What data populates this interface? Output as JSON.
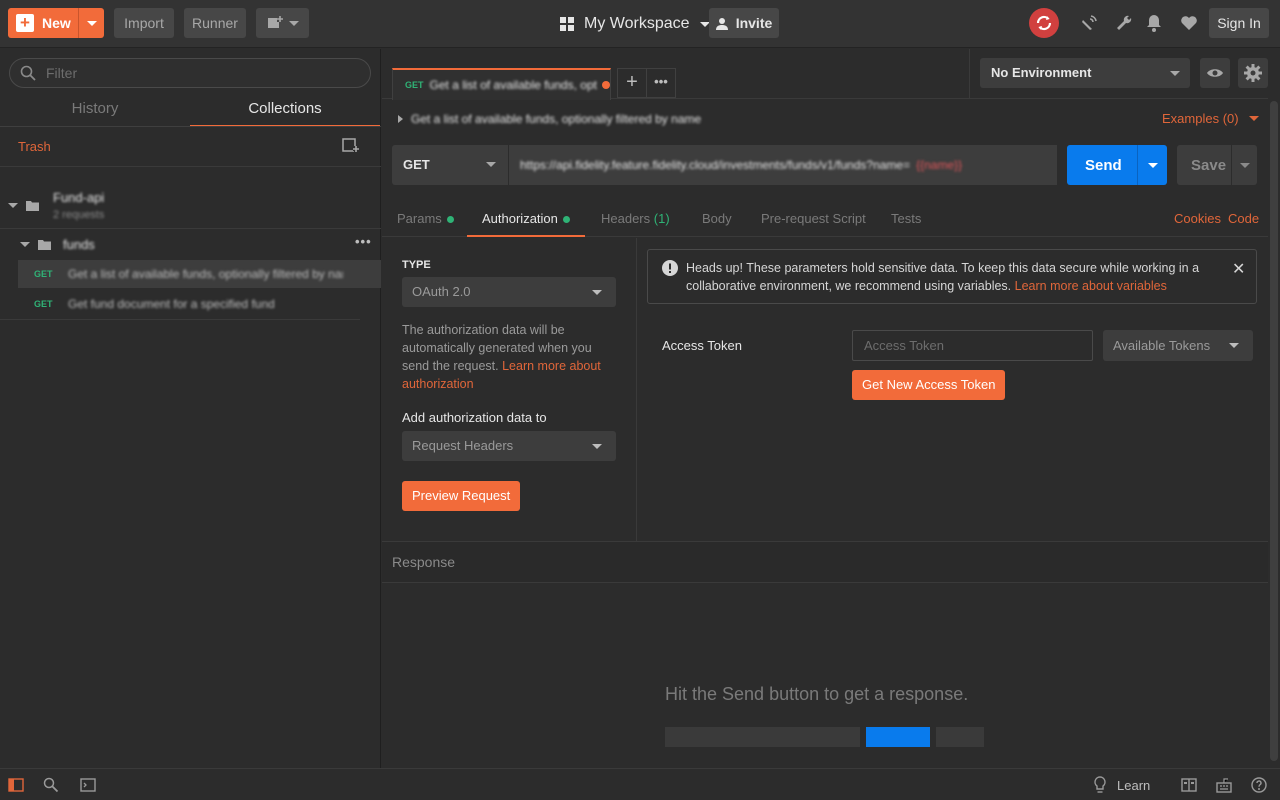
{
  "header": {
    "new_label": "New",
    "import_label": "Import",
    "runner_label": "Runner",
    "workspace_label": "My Workspace",
    "invite_label": "Invite",
    "signin_label": "Sign In"
  },
  "sidebar": {
    "filter_placeholder": "Filter",
    "tabs": [
      "History",
      "Collections"
    ],
    "trash_label": "Trash",
    "collection": {
      "name": "Fund-api",
      "subtitle": "2 requests"
    },
    "folder": {
      "name": "funds"
    },
    "requests": [
      {
        "method": "GET",
        "name": "Get a list of available funds, optionally filtered by name"
      },
      {
        "method": "GET",
        "name": "Get fund document for a specified fund"
      }
    ]
  },
  "request_tab": {
    "method": "GET",
    "title": "Get a list of available funds, opt"
  },
  "environment": {
    "selected": "No Environment"
  },
  "request": {
    "description": "Get a list of available funds, optionally filtered by name",
    "examples_label": "Examples (0)",
    "method": "GET",
    "url": "https://api.fidelity.feature.fidelity.cloud/investments/funds/v1/funds?name=",
    "url_var": "{{name}}",
    "send_label": "Send",
    "save_label": "Save"
  },
  "req_tabs": {
    "params": "Params",
    "authorization": "Authorization",
    "headers": "Headers",
    "headers_count": "(1)",
    "body": "Body",
    "prerequest": "Pre-request Script",
    "tests": "Tests",
    "cookies": "Cookies",
    "code": "Code"
  },
  "auth": {
    "type_label": "TYPE",
    "type_value": "OAuth 2.0",
    "description": "The authorization data will be automatically generated when you send the request.",
    "learn_more": "Learn more about authorization",
    "add_to_label": "Add authorization data to",
    "add_to_value": "Request Headers",
    "preview_label": "Preview Request",
    "alert_text": "Heads up! These parameters hold sensitive data. To keep this data secure while working in a collaborative environment, we recommend using variables.",
    "alert_link": "Learn more about variables",
    "access_token_label": "Access Token",
    "access_token_placeholder": "Access Token",
    "available_tokens": "Available Tokens",
    "get_token_label": "Get New Access Token"
  },
  "response": {
    "title": "Response",
    "hint": "Hit the Send button to get a response."
  },
  "footer": {
    "learn_label": "Learn"
  },
  "colors": {
    "accent": "#f26b3a",
    "primary": "#097bed",
    "get_method": "#2fb376"
  }
}
